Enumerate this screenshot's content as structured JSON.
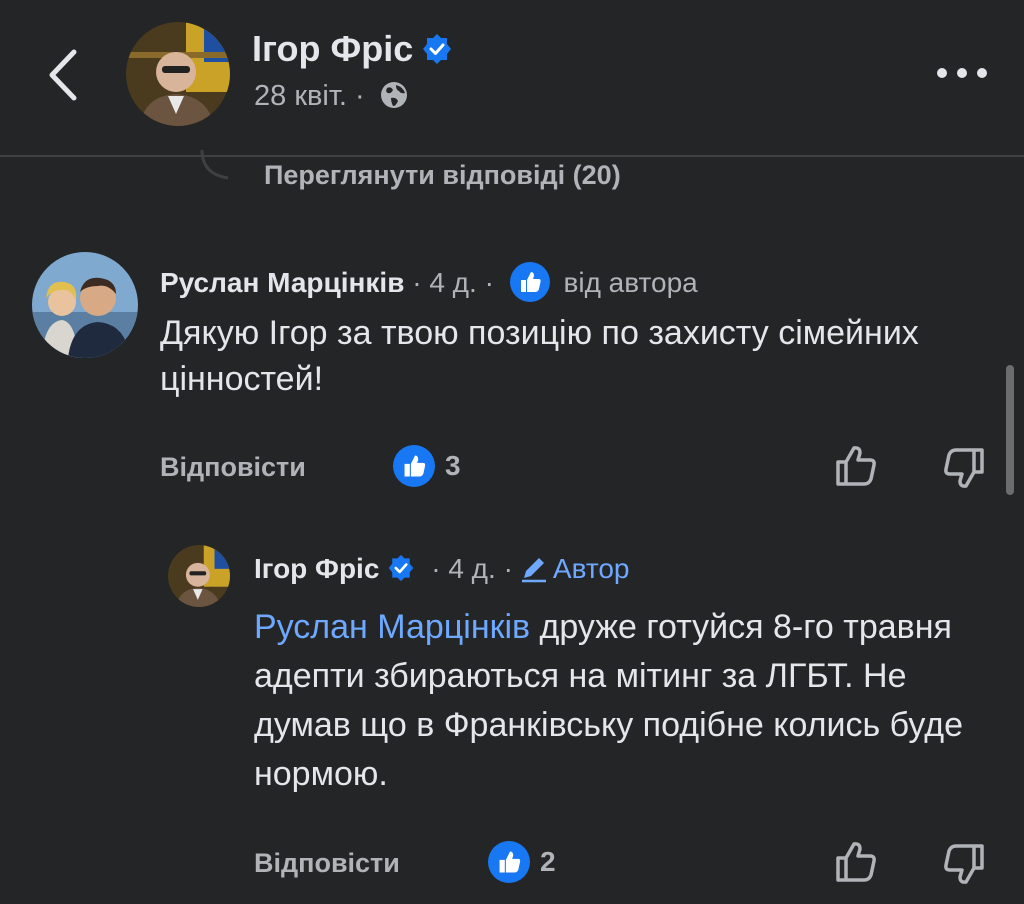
{
  "header": {
    "author_name": "Ігор Фріс",
    "date": "28 квіт.",
    "meta_separator": "·"
  },
  "view_replies_label": "Переглянути відповіді (20)",
  "comments": [
    {
      "author": "Руслан Марцінків",
      "time": "4 д.",
      "separator": "·",
      "badge": "від автора",
      "text": "Дякую Ігор за твою позицію по захисту сімейних цінностей!",
      "reply_label": "Відповісти",
      "reaction_count": "3"
    },
    {
      "author": "Ігор Фріс",
      "time": "4 д.",
      "separator": "·",
      "badge": "Автор",
      "mention": "Руслан Марцінків",
      "text": " друже готуйся 8-го травня адепти збираються на мітинг за ЛГБТ. Не думав що в Франківську подібне колись буде нормою.",
      "reply_label": "Відповісти",
      "reaction_count": "2"
    }
  ],
  "colors": {
    "background": "#242526",
    "text_primary": "#e4e6eb",
    "text_secondary": "#b0b3b8",
    "accent_blue": "#1877f2",
    "mention_blue": "#6ea8ff"
  },
  "icons": [
    "back-chevron-icon",
    "verified-badge-icon",
    "globe-icon",
    "more-options-icon",
    "like-reaction-icon",
    "thumbs-up-icon",
    "thumbs-down-icon",
    "pencil-icon"
  ]
}
